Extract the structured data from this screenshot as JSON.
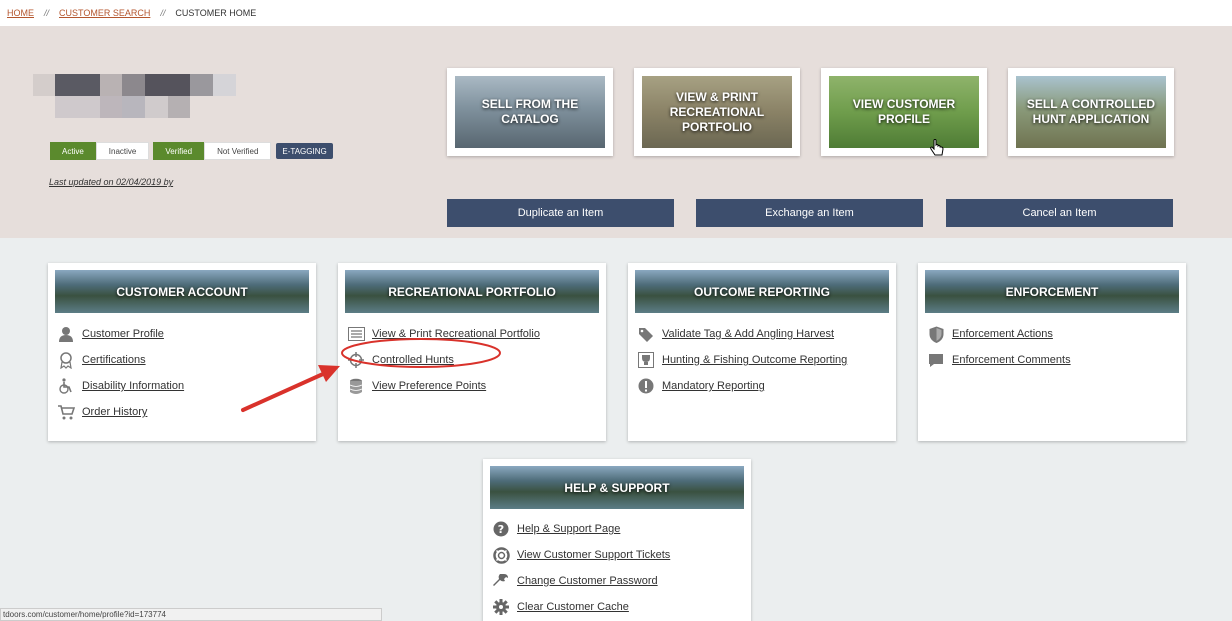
{
  "breadcrumb": {
    "home": "HOME",
    "separator": "//",
    "customer_search": "CUSTOMER SEARCH",
    "current": "CUSTOMER HOME"
  },
  "customer": {
    "status_active": "Active",
    "status_inactive": "Inactive",
    "verified": "Verified",
    "not_verified": "Not Verified",
    "etagging": "E-TAGGING",
    "last_updated": "Last updated on 02/04/2019 by"
  },
  "tiles": [
    {
      "label": "SELL FROM THE CATALOG"
    },
    {
      "label": "VIEW & PRINT RECREATIONAL PORTFOLIO"
    },
    {
      "label": "VIEW CUSTOMER PROFILE"
    },
    {
      "label": "SELL A CONTROLLED HUNT APPLICATION"
    }
  ],
  "actions": {
    "duplicate": "Duplicate an Item",
    "exchange": "Exchange an Item",
    "cancel": "Cancel an Item"
  },
  "cards": {
    "customer_account": {
      "title": "CUSTOMER ACCOUNT",
      "items": [
        "Customer Profile",
        "Certifications",
        "Disability Information",
        "Order History"
      ]
    },
    "recreational_portfolio": {
      "title": "RECREATIONAL PORTFOLIO",
      "items": [
        "View & Print Recreational Portfolio",
        "Controlled Hunts",
        "View Preference Points"
      ]
    },
    "outcome_reporting": {
      "title": "OUTCOME REPORTING",
      "items": [
        "Validate Tag & Add Angling Harvest",
        "Hunting & Fishing Outcome Reporting",
        "Mandatory Reporting"
      ]
    },
    "enforcement": {
      "title": "ENFORCEMENT",
      "items": [
        "Enforcement Actions",
        "Enforcement Comments"
      ]
    },
    "help_support": {
      "title": "HELP & SUPPORT",
      "items": [
        "Help & Support Page",
        "View Customer Support Tickets",
        "Change Customer Password",
        "Clear Customer Cache"
      ]
    }
  },
  "status_bar": {
    "url": "tdoors.com/customer/home/profile?id=173774"
  },
  "colors": {
    "navy": "#3d4e6d",
    "green": "#5b8a2d",
    "link_orange": "#b4562e",
    "hero_bg": "#e6dedb",
    "page_bg": "#ebeeef",
    "annotation_red": "#d9322b"
  },
  "icons": {
    "customer_profile": "user-icon",
    "certifications": "ribbon-icon",
    "disability": "wheelchair-icon",
    "order_history": "cart-icon",
    "print_portfolio": "list-card-icon",
    "controlled_hunts": "crosshair-icon",
    "preference_points": "database-icon",
    "validate_tag": "tags-icon",
    "outcome_reporting": "trophy-icon",
    "mandatory_reporting": "exclamation-icon",
    "enforcement_actions": "shield-icon",
    "enforcement_comments": "comment-icon",
    "help_page": "question-icon",
    "support_tickets": "lifering-icon",
    "change_password": "wrench-icon",
    "clear_cache": "gear-icon",
    "hand_cursor": "hand-pointer-icon"
  }
}
